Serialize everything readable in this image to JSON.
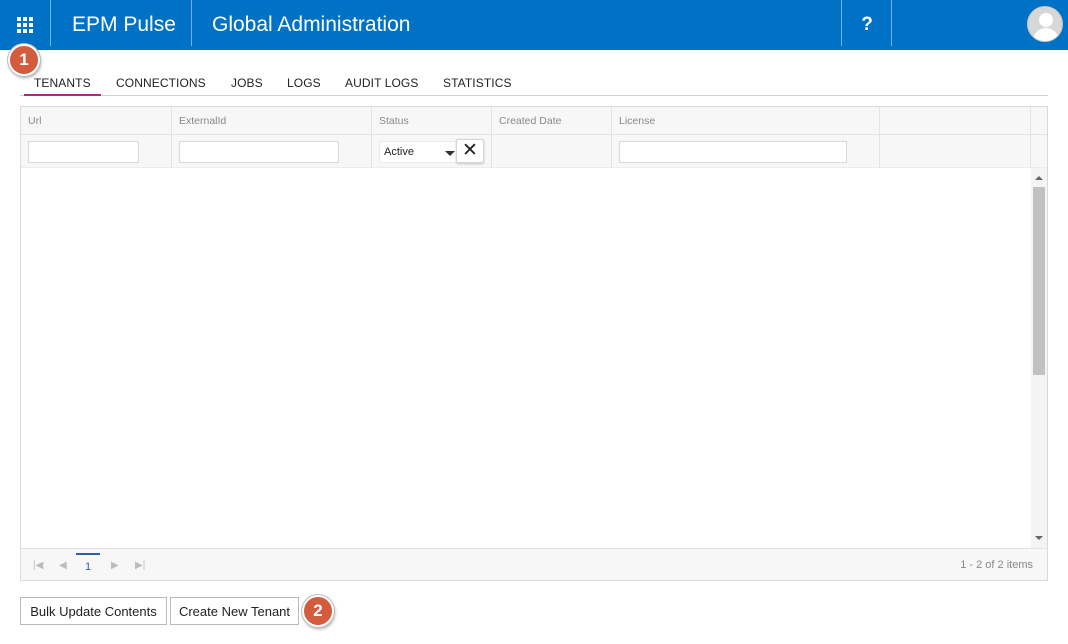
{
  "header": {
    "app_name": "EPM Pulse",
    "page_title": "Global Administration",
    "help_label": "?",
    "bg_color": "#0072c6"
  },
  "callouts": [
    "1",
    "2"
  ],
  "tabs": [
    {
      "label": "TENANTS",
      "active": true
    },
    {
      "label": "CONNECTIONS",
      "active": false
    },
    {
      "label": "JOBS",
      "active": false
    },
    {
      "label": "LOGS",
      "active": false
    },
    {
      "label": "AUDIT LOGS",
      "active": false
    },
    {
      "label": "STATISTICS",
      "active": false
    }
  ],
  "grid": {
    "columns": [
      "Url",
      "ExternalId",
      "Status",
      "Created Date",
      "License"
    ],
    "filters": {
      "url": "",
      "external_id": "",
      "status": "Active",
      "clear_label": "✕",
      "license": ""
    },
    "rows": []
  },
  "pager": {
    "current_page": "1",
    "info": "1 - 2 of 2 items"
  },
  "actions": {
    "bulk_update": "Bulk Update Contents",
    "create_tenant": "Create New Tenant"
  },
  "accent_color": "#b4287a",
  "callout_color": "#d35b3e"
}
